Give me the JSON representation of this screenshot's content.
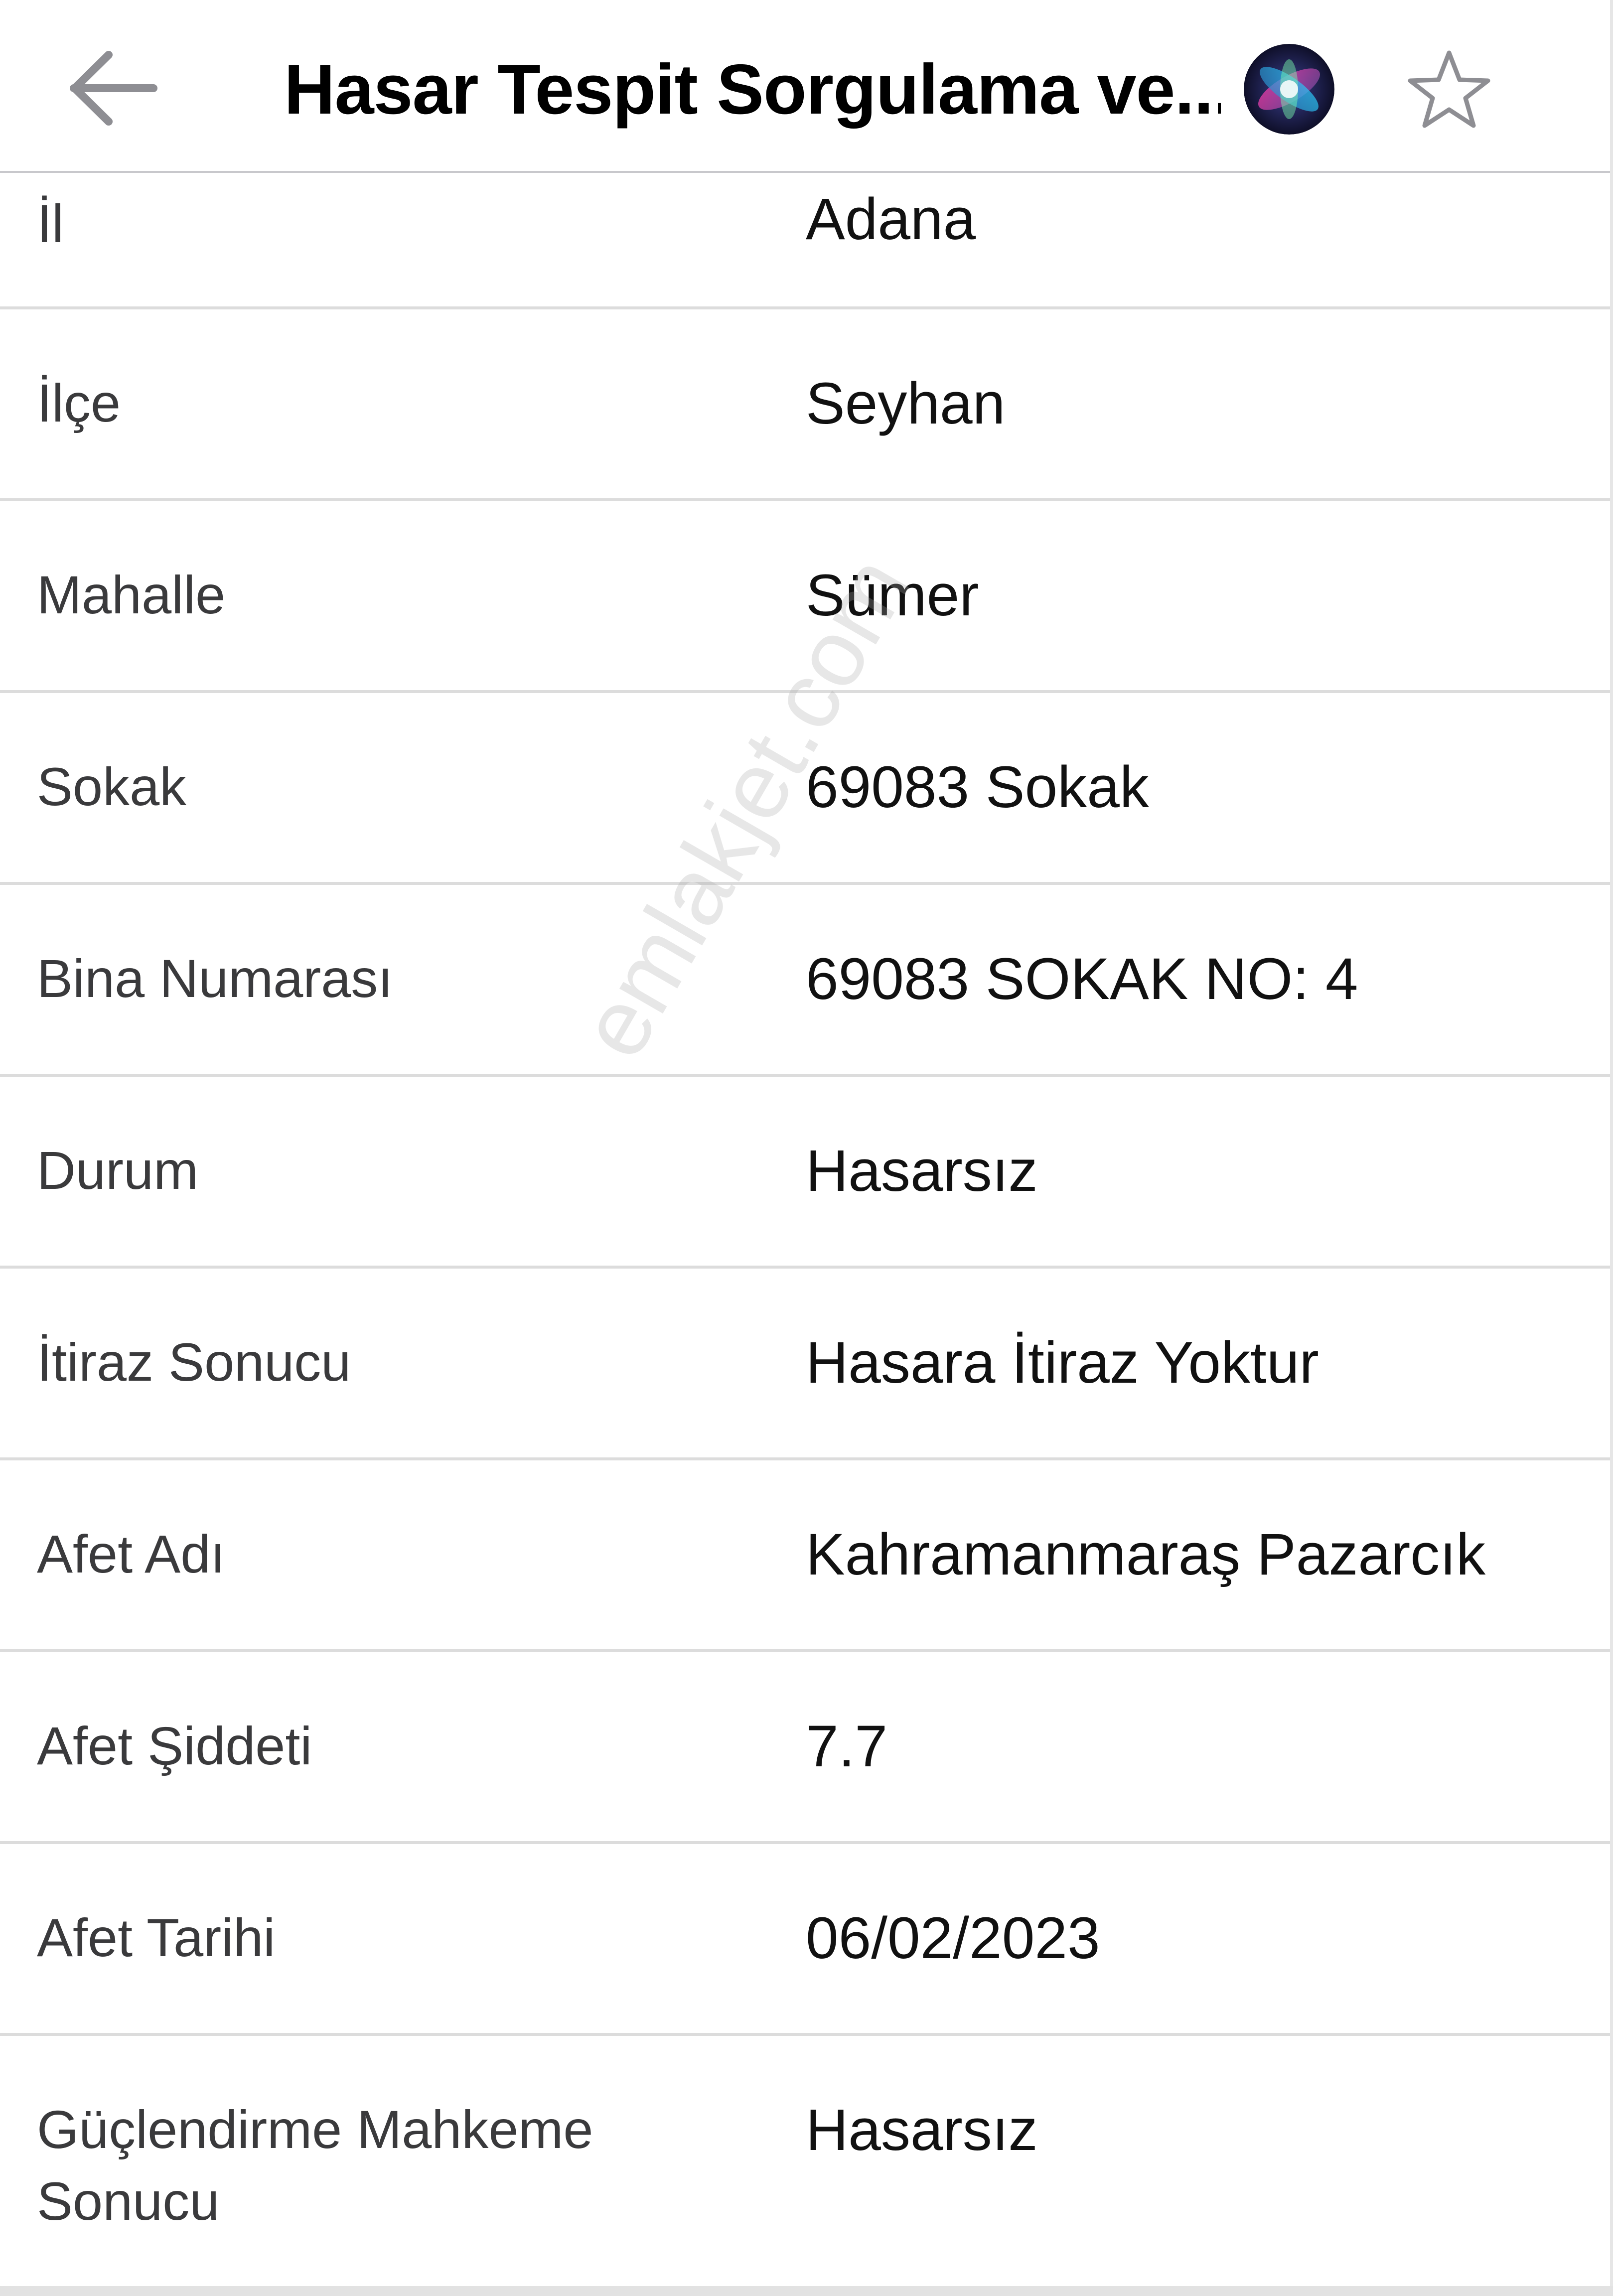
{
  "header": {
    "back_icon": "arrow-left-icon",
    "title": "Hasar Tespit Sorgulama ve...",
    "assistant_icon": "siri-icon",
    "favorite_icon": "star-outline-icon"
  },
  "rows": [
    {
      "label": "İl",
      "value": "Adana"
    },
    {
      "label": "İlçe",
      "value": "Seyhan"
    },
    {
      "label": "Mahalle",
      "value": "Sümer"
    },
    {
      "label": "Sokak",
      "value": "69083 Sokak"
    },
    {
      "label": "Bina Numarası",
      "value": "69083 SOKAK NO: 4"
    },
    {
      "label": "Durum",
      "value": "Hasarsız"
    },
    {
      "label": "İtiraz Sonucu",
      "value": "Hasara İtiraz Yoktur"
    },
    {
      "label": "Afet Adı",
      "value": "Kahramanmaraş Pazarcık"
    },
    {
      "label": "Afet Şiddeti",
      "value": "7.7"
    },
    {
      "label": "Afet Tarihi",
      "value": "06/02/2023"
    },
    {
      "label_line1": "Güçlendirme Mahkeme",
      "label_line2": "Sonucu",
      "value": "Hasarsız"
    }
  ],
  "watermark": "emlakjet.com",
  "colors": {
    "label_text": "#3a3a3c",
    "value_text": "#111111",
    "divider": "#dcdcdc",
    "icon_gray": "#8e8e93"
  }
}
